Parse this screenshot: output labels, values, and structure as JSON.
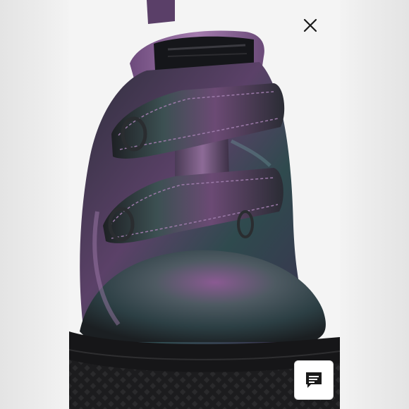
{
  "viewer": {
    "photo_alt": "",
    "close_label": "",
    "chat_label": ""
  },
  "colors": {
    "shoe_purple": "#7a4f86",
    "shoe_teal": "#2f4a4e",
    "sole_black": "#1a1a1c",
    "background": "#f0f0f0"
  },
  "icons": {
    "close": "close-icon",
    "chat": "chat-icon"
  }
}
